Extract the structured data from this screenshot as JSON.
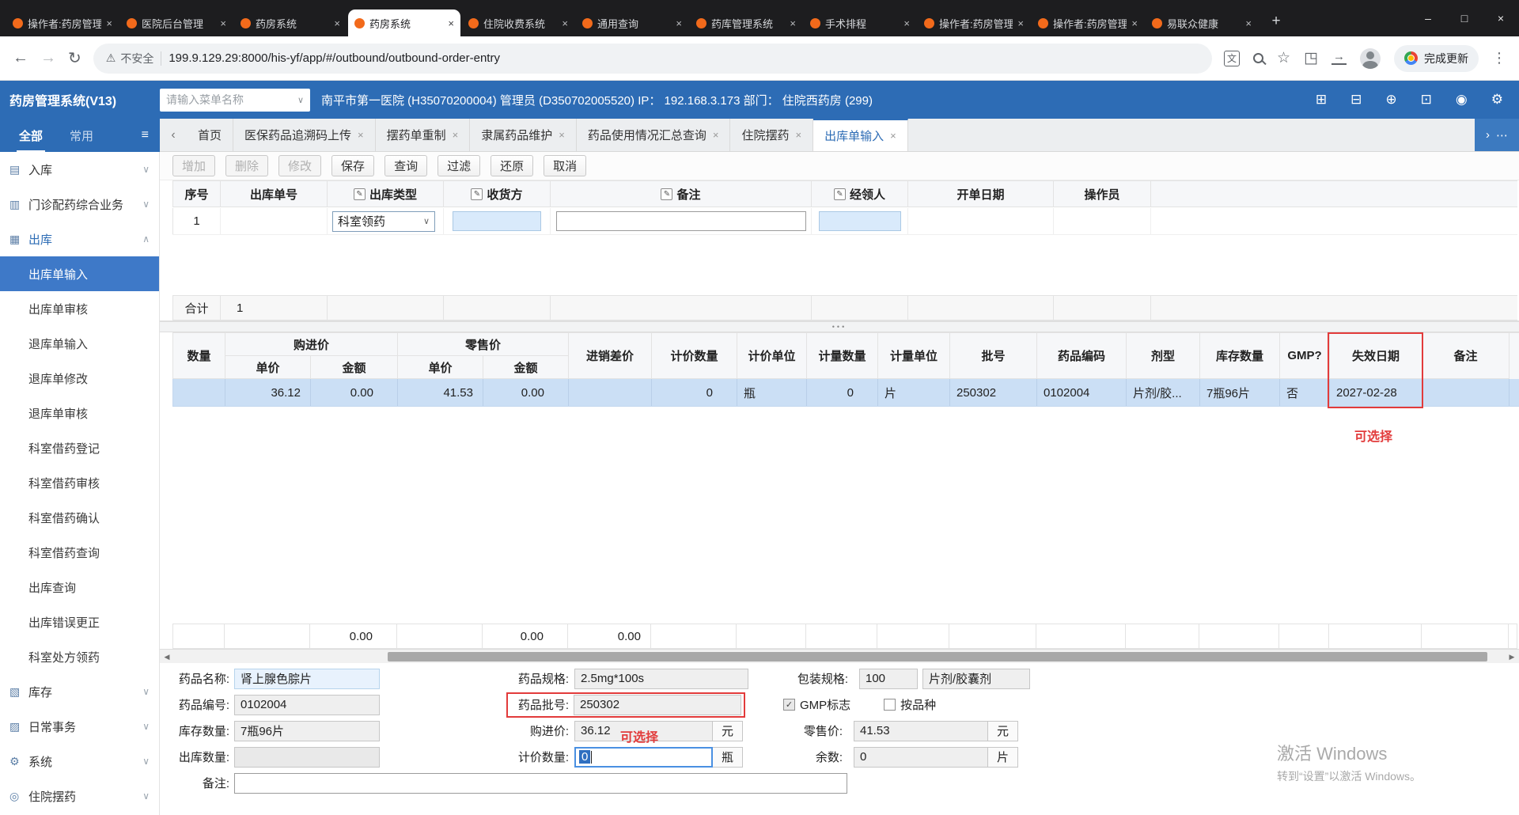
{
  "icons": {
    "close": "×",
    "chevron_down": "∨",
    "chevron_up": "∧",
    "chevron_left": "‹",
    "chevron_right": "›",
    "more_h": "⋯",
    "more_v": "⋮",
    "hamburger": "≡",
    "back": "←",
    "forward": "→",
    "refresh": "↻",
    "warning": "⚠",
    "star": "☆",
    "extensions": "◳",
    "translate": "文",
    "minimize": "–",
    "maximize": "□",
    "plus": "+",
    "check": "✓",
    "edit": "✎",
    "scroll_left": "◀",
    "scroll_right": "▶",
    "dots": "•••",
    "inbound": "▤",
    "clinic": "▥",
    "outbound": "▦",
    "stock": "▧",
    "daily": "▨",
    "system": "⚙",
    "ward": "◎",
    "h1": "⊞",
    "h2": "⊟",
    "h3": "⊕",
    "h4": "⊡",
    "h5": "◉",
    "h6": "⚙"
  },
  "browser": {
    "tabs": [
      {
        "title": "操作者:药房管理"
      },
      {
        "title": "医院后台管理"
      },
      {
        "title": "药房系统"
      },
      {
        "title": "药房系统"
      },
      {
        "title": "住院收费系统"
      },
      {
        "title": "通用查询"
      },
      {
        "title": "药库管理系统"
      },
      {
        "title": "手术排程"
      },
      {
        "title": "操作者:药房管理"
      },
      {
        "title": "操作者:药房管理"
      },
      {
        "title": "易联众健康"
      }
    ],
    "security_label": "不安全",
    "url": "199.9.129.29:8000/his-yf/app/#/outbound/outbound-order-entry",
    "update_label": "完成更新"
  },
  "app": {
    "title": "药房管理系统(V13)",
    "menu_search_placeholder": "请输入菜单名称",
    "org_info": "南平市第一医院 (H35070200004) 管理员 (D350702005520) IP： 192.168.3.173 部门： 住院西药房 (299)"
  },
  "sidebar": {
    "tabs": [
      {
        "label": "全部"
      },
      {
        "label": "常用"
      }
    ],
    "items": [
      {
        "label": "入库"
      },
      {
        "label": "门诊配药综合业务"
      },
      {
        "label": "出库"
      },
      {
        "label": "出库单输入"
      },
      {
        "label": "出库单审核"
      },
      {
        "label": "退库单输入"
      },
      {
        "label": "退库单修改"
      },
      {
        "label": "退库单审核"
      },
      {
        "label": "科室借药登记"
      },
      {
        "label": "科室借药审核"
      },
      {
        "label": "科室借药确认"
      },
      {
        "label": "科室借药查询"
      },
      {
        "label": "出库查询"
      },
      {
        "label": "出库错误更正"
      },
      {
        "label": "科室处方领药"
      },
      {
        "label": "库存"
      },
      {
        "label": "日常事务"
      },
      {
        "label": "系统"
      },
      {
        "label": "住院摆药"
      }
    ]
  },
  "workspace": {
    "tabs": [
      {
        "label": "首页"
      },
      {
        "label": "医保药品追溯码上传"
      },
      {
        "label": "摆药单重制"
      },
      {
        "label": "隶属药品维护"
      },
      {
        "label": "药品使用情况汇总查询"
      },
      {
        "label": "住院摆药"
      },
      {
        "label": "出库单输入"
      }
    ]
  },
  "toolbar": {
    "buttons": [
      {
        "label": "增加"
      },
      {
        "label": "删除"
      },
      {
        "label": "修改"
      },
      {
        "label": "保存"
      },
      {
        "label": "查询"
      },
      {
        "label": "过滤"
      },
      {
        "label": "还原"
      },
      {
        "label": "取消"
      }
    ]
  },
  "order_grid": {
    "columns": {
      "seq": "序号",
      "order_no": "出库单号",
      "type": "出库类型",
      "receiver": "收货方",
      "remark": "备注",
      "collector": "经领人",
      "date": "开单日期",
      "operator": "操作员"
    },
    "row": {
      "seq": "1",
      "type_value": "科室领药"
    },
    "footer": {
      "label": "合计",
      "count": "1"
    }
  },
  "detail_grid": {
    "columns": {
      "qty": "数量",
      "purchase": "购进价",
      "retail": "零售价",
      "unit_price": "单价",
      "amount": "金额",
      "price_diff": "进销差价",
      "price_qty": "计价数量",
      "price_unit": "计价单位",
      "measure_qty": "计量数量",
      "measure_unit": "计量单位",
      "batch": "批号",
      "drug_code": "药品编码",
      "dosage_form": "剂型",
      "stock_qty": "库存数量",
      "gmp": "GMP?",
      "expiry": "失效日期",
      "remark": "备注"
    },
    "row": {
      "purchase_price": "36.12",
      "purchase_amount": "0.00",
      "retail_price": "41.53",
      "retail_amount": "0.00",
      "price_qty": "0",
      "price_unit": "瓶",
      "measure_qty": "0",
      "measure_unit": "片",
      "batch": "250302",
      "drug_code": "0102004",
      "dosage_form": "片剂/胶...",
      "stock_qty": "7瓶96片",
      "gmp": "否",
      "expiry": "2027-02-28"
    },
    "totals": {
      "purchase_amount": "0.00",
      "retail_amount": "0.00",
      "price_diff": "0.00"
    },
    "annotation": "可选择"
  },
  "form": {
    "drug_name": {
      "label": "药品名称:",
      "value": "肾上腺色腙片"
    },
    "drug_spec": {
      "label": "药品规格:",
      "value": "2.5mg*100s"
    },
    "pack_spec": {
      "label": "包装规格:",
      "value": "100",
      "value2": "片剂/胶囊剂"
    },
    "drug_code": {
      "label": "药品编号:",
      "value": "0102004"
    },
    "batch_no": {
      "label": "药品批号:",
      "value": "250302"
    },
    "gmp_flag": {
      "label": "GMP标志"
    },
    "by_variety": {
      "label": "按品种"
    },
    "stock_qty": {
      "label": "库存数量:",
      "value": "7瓶96片"
    },
    "purchase_price": {
      "label": "购进价:",
      "value": "36.12",
      "unit": "元"
    },
    "retail_price": {
      "label": "零售价:",
      "value": "41.53",
      "unit": "元"
    },
    "outbound_qty": {
      "label": "出库数量:",
      "value": ""
    },
    "price_qty": {
      "label": "计价数量:",
      "value": "0",
      "unit": "瓶"
    },
    "remainder": {
      "label": "余数:",
      "value": "0",
      "unit": "片"
    },
    "remark": {
      "label": "备注:",
      "value": ""
    },
    "annotation": "可选择"
  },
  "watermark": {
    "line1": "激活 Windows",
    "line2": "转到“设置”以激活 Windows。"
  }
}
